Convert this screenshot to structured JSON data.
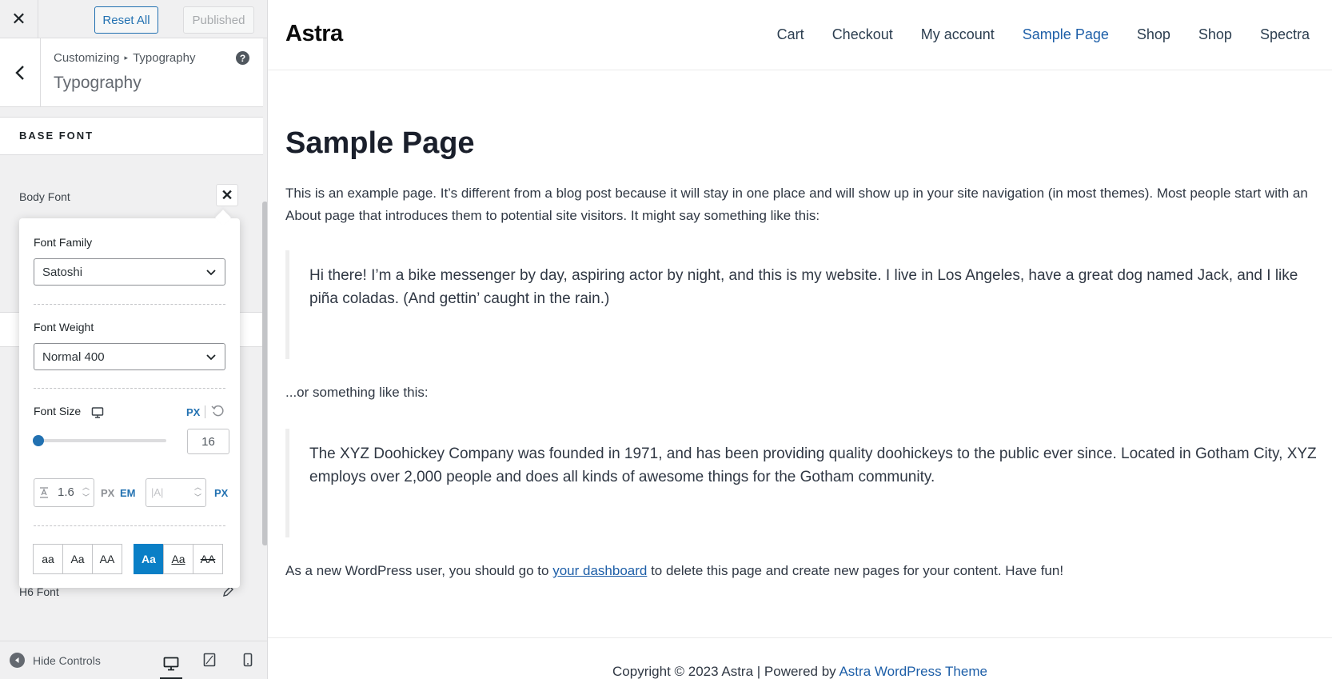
{
  "sidebar": {
    "close_glyph": "✕",
    "reset_label": "Reset All",
    "publish_label": "Published",
    "breadcrumb": {
      "root": "Customizing",
      "sep": "▸",
      "current": "Typography"
    },
    "section_title": "Typography",
    "help_glyph": "?",
    "base_font_heading": "BASE FONT",
    "body_font_label": "Body Font",
    "body_font_close": "✕",
    "h6_label": "H6 Font",
    "hide_controls_label": "Hide Controls"
  },
  "popover": {
    "family_label": "Font Family",
    "family_value": "Satoshi",
    "weight_label": "Font Weight",
    "weight_value": "Normal 400",
    "size_label": "Font Size",
    "size_unit": "PX",
    "size_value": "16",
    "size_fraction": 0.0,
    "line_height_value": "1.6",
    "line_units": [
      "PX",
      "EM"
    ],
    "letter_spacing_placeholder": "|A|",
    "letter_unit": "PX",
    "transforms": [
      "aa",
      "Aa",
      "AA"
    ],
    "decorations": [
      "Aa",
      "Aa",
      "AA"
    ]
  },
  "preview": {
    "logo": "Astra",
    "nav": [
      "Cart",
      "Checkout",
      "My account",
      "Sample Page",
      "Shop",
      "Shop",
      "Spectra"
    ],
    "active_nav": "Sample Page",
    "title": "Sample Page",
    "intro": "This is an example page. It’s different from a blog post because it will stay in one place and will show up in your site navigation (in most themes). Most people start with an About page that introduces them to potential site visitors. It might say something like this:",
    "quote1": "Hi there! I’m a bike messenger by day, aspiring actor by night, and this is my website. I live in Los Angeles, have a great dog named Jack, and I like piña coladas. (And gettin’ caught in the rain.)",
    "or_text": "...or something like this:",
    "quote2": "The XYZ Doohickey Company was founded in 1971, and has been providing quality doohickeys to the public ever since. Located in Gotham City, XYZ employs over 2,000 people and does all kinds of awesome things for the Gotham community.",
    "closing_before": "As a new WordPress user, you should go to ",
    "closing_link": "your dashboard",
    "closing_after": " to delete this page and create new pages for your content. Have fun!",
    "footer_before": "Copyright © 2023 Astra | Powered by ",
    "footer_link": "Astra WordPress Theme"
  },
  "colors": {
    "accent": "#2271b1",
    "active_toggle": "#0a7fc6",
    "link": "#1e5fa8"
  }
}
